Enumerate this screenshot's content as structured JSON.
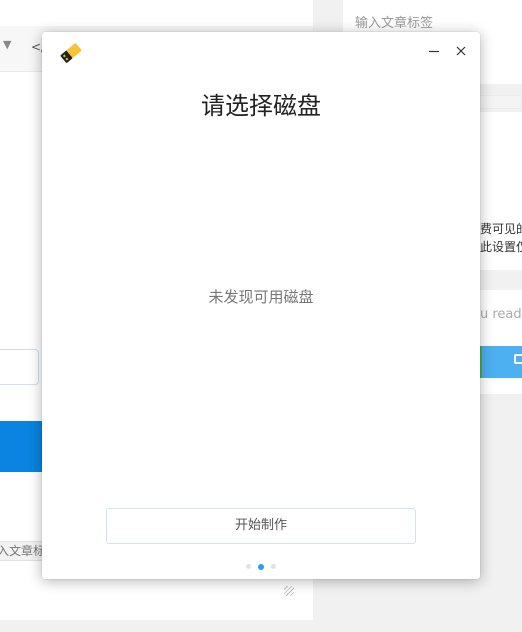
{
  "background": {
    "side_tag_placeholder": "输入文章标签",
    "side_text_line1": "费可见的",
    "side_text_line2": "此设置仅",
    "side_text_line3": "u ready",
    "editor_tag_field": "入文章标"
  },
  "dialog": {
    "title": "请选择磁盘",
    "empty_message": "未发现可用磁盘",
    "start_button": "开始制作",
    "pager": {
      "total": 3,
      "active_index": 1
    }
  },
  "colors": {
    "accent": "#2e9de6",
    "background_blue": "#0a84e0",
    "button_border": "#cfe3f5",
    "icon_yellow": "#f6c338"
  },
  "icons": {
    "app": "usb-drive-icon",
    "minimize": "minimize-icon",
    "close": "close-icon"
  }
}
